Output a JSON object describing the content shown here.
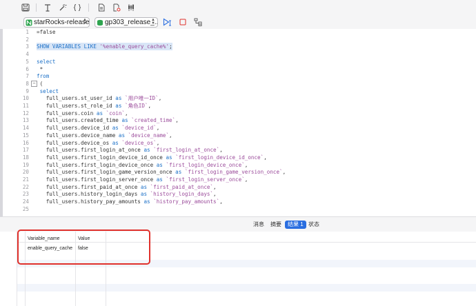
{
  "toolbar": {
    "icons": [
      "save-icon",
      "format-icon",
      "magic-wand-icon",
      "braces-icon",
      "document-icon",
      "document-refresh-icon",
      "candlestick-chart-icon"
    ]
  },
  "selectors": {
    "connection": "starRocks-release",
    "database": "gp303_release_..."
  },
  "editor": {
    "lines": [
      {
        "n": "1",
        "t": "=false"
      },
      {
        "n": "2",
        "t": ""
      },
      {
        "n": "3",
        "t": "SHOW VARIABLES LIKE '%enable_query_cache%';"
      },
      {
        "n": "4",
        "t": ""
      },
      {
        "n": "5",
        "t": "select"
      },
      {
        "n": "6",
        "t": " *"
      },
      {
        "n": "7",
        "t": "from"
      },
      {
        "n": "8",
        "t": " ("
      },
      {
        "n": "9",
        "t": " select"
      },
      {
        "n": "10",
        "t": "   full_users.st_user_id as `用户唯一ID`,"
      },
      {
        "n": "11",
        "t": "   full_users.st_role_id as `角色ID`,"
      },
      {
        "n": "12",
        "t": "   full_users.coin as `coin`,"
      },
      {
        "n": "13",
        "t": "   full_users.created_time as `created_time`,"
      },
      {
        "n": "14",
        "t": "   full_users.device_id as `device_id`,"
      },
      {
        "n": "15",
        "t": "   full_users.device_name as `device_name`,"
      },
      {
        "n": "16",
        "t": "   full_users.device_os as `device_os`,"
      },
      {
        "n": "17",
        "t": "   full_users.first_login_at_once as `first_login_at_once`,"
      },
      {
        "n": "18",
        "t": "   full_users.first_login_device_id_once as `first_login_device_id_once`,"
      },
      {
        "n": "19",
        "t": "   full_users.first_login_device_once as `first_login_device_once`,"
      },
      {
        "n": "20",
        "t": "   full_users.first_login_game_version_once as `first_login_game_version_once`,"
      },
      {
        "n": "21",
        "t": "   full_users.first_login_server_once as `first_login_server_once`,"
      },
      {
        "n": "22",
        "t": "   full_users.first_paid_at_once as `first_paid_at_once`,"
      },
      {
        "n": "23",
        "t": "   full_users.history_login_days as `history_login_days`,"
      },
      {
        "n": "24",
        "t": "   full_users.history_pay_amounts as `history_pay_amounts`,"
      },
      {
        "n": "25",
        "t": ""
      }
    ]
  },
  "result_tabs": [
    {
      "label": "消息",
      "active": false
    },
    {
      "label": "摘要",
      "active": false
    },
    {
      "label": "结果 1",
      "active": true
    },
    {
      "label": "状态",
      "active": false
    }
  ],
  "result_grid": {
    "columns": [
      "Variable_name",
      "Value"
    ],
    "rows": [
      [
        "enable_query_cache",
        "false"
      ]
    ]
  },
  "colors": {
    "accent": "#2a6ee0",
    "highlight_box": "#e0302b",
    "keyword": "#1a6fc7"
  }
}
